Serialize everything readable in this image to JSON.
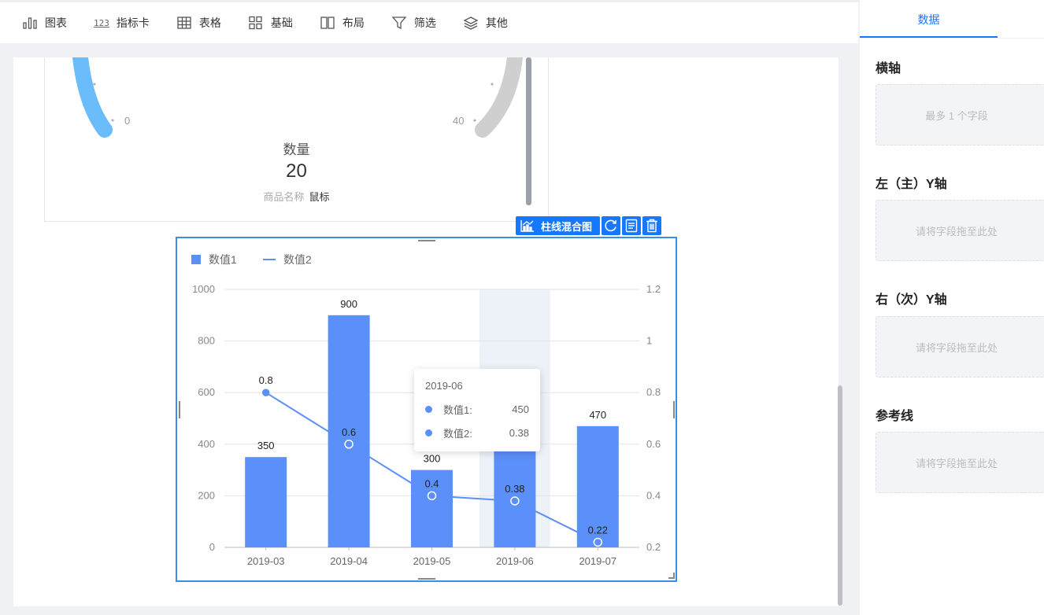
{
  "toolbar": {
    "items": [
      {
        "label": "图表",
        "icon": "bar-chart-icon"
      },
      {
        "label": "指标卡",
        "icon": "number-icon",
        "glyph": "123"
      },
      {
        "label": "表格",
        "icon": "table-icon"
      },
      {
        "label": "基础",
        "icon": "grid-icon"
      },
      {
        "label": "布局",
        "icon": "layout-icon"
      },
      {
        "label": "筛选",
        "icon": "filter-icon"
      },
      {
        "label": "其他",
        "icon": "layers-icon"
      }
    ]
  },
  "gauge": {
    "min_label": "0",
    "max_label": "40",
    "name": "数量",
    "value": "20",
    "legend_key": "商品名称",
    "legend_value": "鼠标",
    "colors": {
      "filled": "#6bbcfb",
      "track": "#cfcfcf"
    }
  },
  "chart_widget": {
    "type_label": "柱线混合图",
    "actions": [
      "refresh-icon",
      "detail-icon",
      "delete-icon"
    ]
  },
  "chart_data": {
    "type": "bar",
    "combo": "bar+line",
    "categories": [
      "2019-03",
      "2019-04",
      "2019-05",
      "2019-06",
      "2019-07"
    ],
    "series": [
      {
        "name": "数值1",
        "type": "bar",
        "axis": "left",
        "values": [
          350,
          900,
          300,
          450,
          470
        ],
        "color": "#5b8ff9"
      },
      {
        "name": "数值2",
        "type": "line",
        "axis": "right",
        "values": [
          0.8,
          0.6,
          0.4,
          0.38,
          0.22
        ],
        "color": "#5b8ff9"
      }
    ],
    "y_left": {
      "ticks": [
        "0",
        "200",
        "400",
        "600",
        "800",
        "1000"
      ],
      "range": [
        0,
        1000
      ]
    },
    "y_right": {
      "ticks": [
        "0.2",
        "0.4",
        "0.6",
        "0.8",
        "1",
        "1.2"
      ],
      "range": [
        0.2,
        1.2
      ]
    },
    "point_labels": {
      "bar": [
        "350",
        "900",
        "300",
        "450",
        "470"
      ],
      "line": [
        "0.8",
        "0.6",
        "0.4",
        "0.38",
        "0.22"
      ]
    },
    "grid": true,
    "legend_position": "top-left",
    "highlighted_category": "2019-06"
  },
  "tooltip": {
    "title": "2019-06",
    "rows": [
      {
        "name": "数值1:",
        "value": "450"
      },
      {
        "name": "数值2:",
        "value": "0.38"
      }
    ]
  },
  "panel": {
    "tab": "数据",
    "sections": [
      {
        "title": "横轴",
        "placeholder": "最多 1 个字段"
      },
      {
        "title": "左（主）Y轴",
        "placeholder": "请将字段拖至此处"
      },
      {
        "title": "右（次）Y轴",
        "placeholder": "请将字段拖至此处"
      },
      {
        "title": "参考线",
        "placeholder": "请将字段拖至此处"
      }
    ]
  }
}
